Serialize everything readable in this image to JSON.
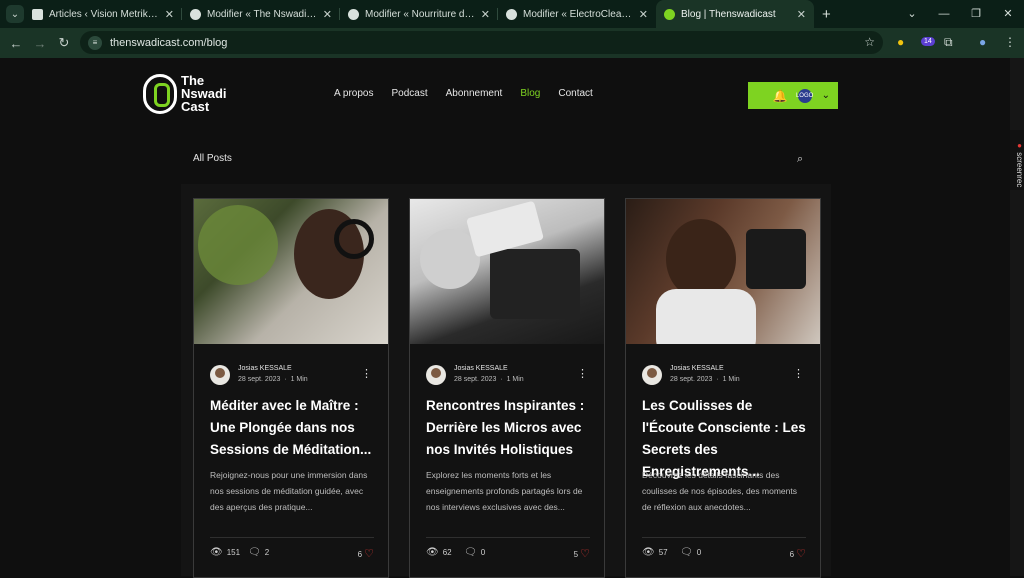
{
  "browser": {
    "tabs": [
      {
        "title": "Articles ‹ Vision Metrik — WordPress",
        "favicon_color": "#d9e1dd",
        "active": false
      },
      {
        "title": "Modifier « The Nswadi Cast » ‹ ...",
        "favicon_color": "#d9e1dd",
        "active": false
      },
      {
        "title": "Modifier « Nourriture du bonheur ...",
        "favicon_color": "#d9e1dd",
        "active": false
      },
      {
        "title": "Modifier « ElectroClean Market ...",
        "favicon_color": "#d9e1dd",
        "active": false
      },
      {
        "title": "Blog | Thenswadicast",
        "favicon_color": "#7ed321",
        "active": true
      }
    ],
    "url": "thenswadicast.com/blog",
    "new_tab_icon": "+",
    "window_controls": [
      "⌄",
      "—",
      "❐",
      "✕"
    ],
    "extension_badge": "14"
  },
  "site": {
    "logo": {
      "line1": "The",
      "line2": "Nswadi",
      "line3": "Cast"
    },
    "nav": [
      {
        "label": "A propos",
        "active": false
      },
      {
        "label": "Podcast",
        "active": false
      },
      {
        "label": "Abonnement",
        "active": false
      },
      {
        "label": "Blog",
        "active": true
      },
      {
        "label": "Contact",
        "active": false
      }
    ],
    "header_box": {
      "bell_icon": "🔔",
      "avatar_text": "LOGO",
      "chevron": "⌄"
    },
    "all_posts": "All Posts",
    "search_icon": "⌕"
  },
  "posts": [
    {
      "author": "Josias KESSALE",
      "date": "28 sept. 2023",
      "read_time": "1 Min",
      "title": "Méditer avec le Maître : Une Plongée dans nos Sessions de Méditation...",
      "excerpt": "Rejoignez-nous pour une immersion dans nos sessions de méditation guidée, avec des aperçus des pratique...",
      "views": "151",
      "comments": "2",
      "likes": "6"
    },
    {
      "author": "Josias KESSALE",
      "date": "28 sept. 2023",
      "read_time": "1 Min",
      "title": "Rencontres Inspirantes : Derrière les Micros avec nos Invités Holistiques",
      "excerpt": "Explorez les moments forts et les enseignements profonds partagés lors de nos interviews exclusives avec des...",
      "views": "62",
      "comments": "0",
      "likes": "5"
    },
    {
      "author": "Josias KESSALE",
      "date": "28 sept. 2023",
      "read_time": "1 Min",
      "title": "Les Coulisses de l'Écoute Consciente : Les Secrets des Enregistrements...",
      "excerpt": "Découvrez les détails fascinants des coulisses de nos épisodes, des moments de réflexion aux anecdotes...",
      "views": "57",
      "comments": "0",
      "likes": "6"
    }
  ],
  "colors": {
    "accent": "#7ed321",
    "background": "#0f0f0f",
    "card_border": "#3a3a3a"
  }
}
